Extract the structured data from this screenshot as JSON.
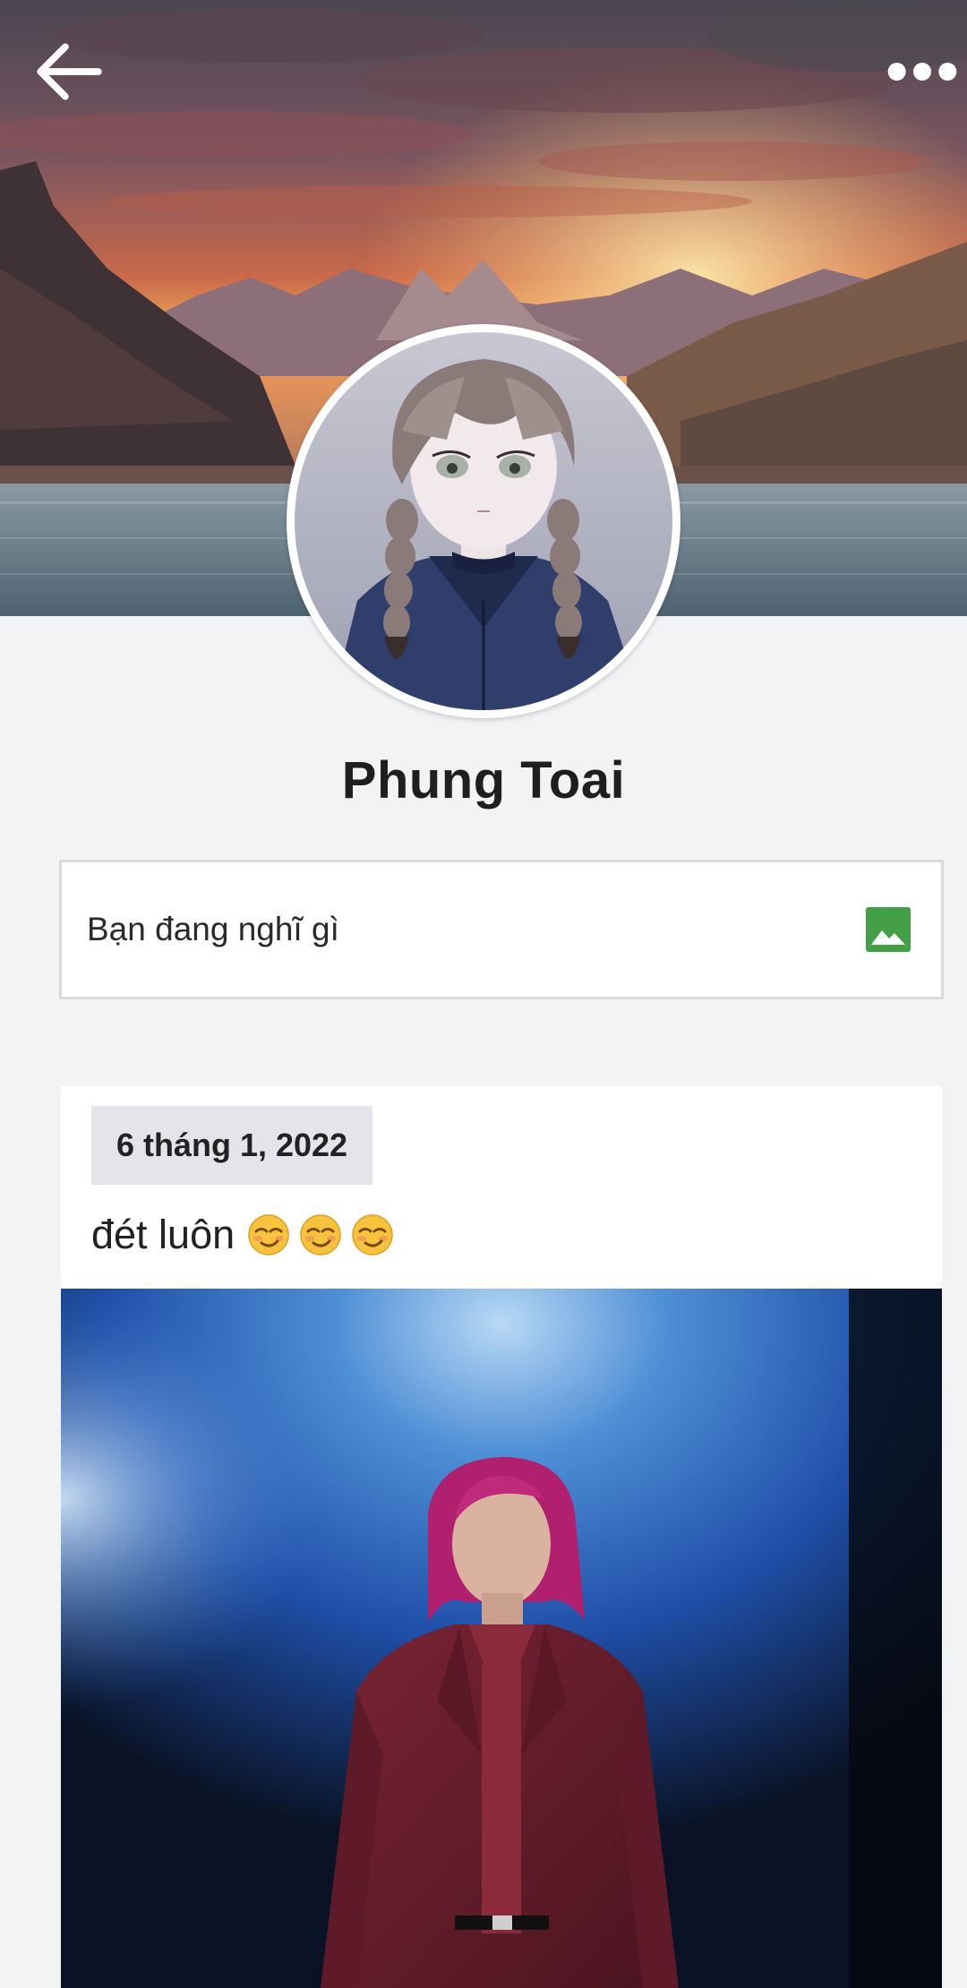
{
  "header": {
    "back_icon": "arrow-left-icon",
    "more_icon": "more-horizontal-icon"
  },
  "profile": {
    "name": "Phung Toai"
  },
  "composer": {
    "placeholder": "Bạn đang nghĩ gì",
    "photo_icon": "image-icon",
    "photo_icon_color": "#43a047"
  },
  "post": {
    "date": "6 tháng 1, 2022",
    "text": "đét luôn",
    "emojis": [
      "smirk-face-emoji",
      "smirk-face-emoji",
      "smirk-face-emoji"
    ]
  },
  "colors": {
    "background": "#f2f3f5",
    "card": "#ffffff",
    "date_badge": "#e3e5ea",
    "text": "#222222"
  }
}
